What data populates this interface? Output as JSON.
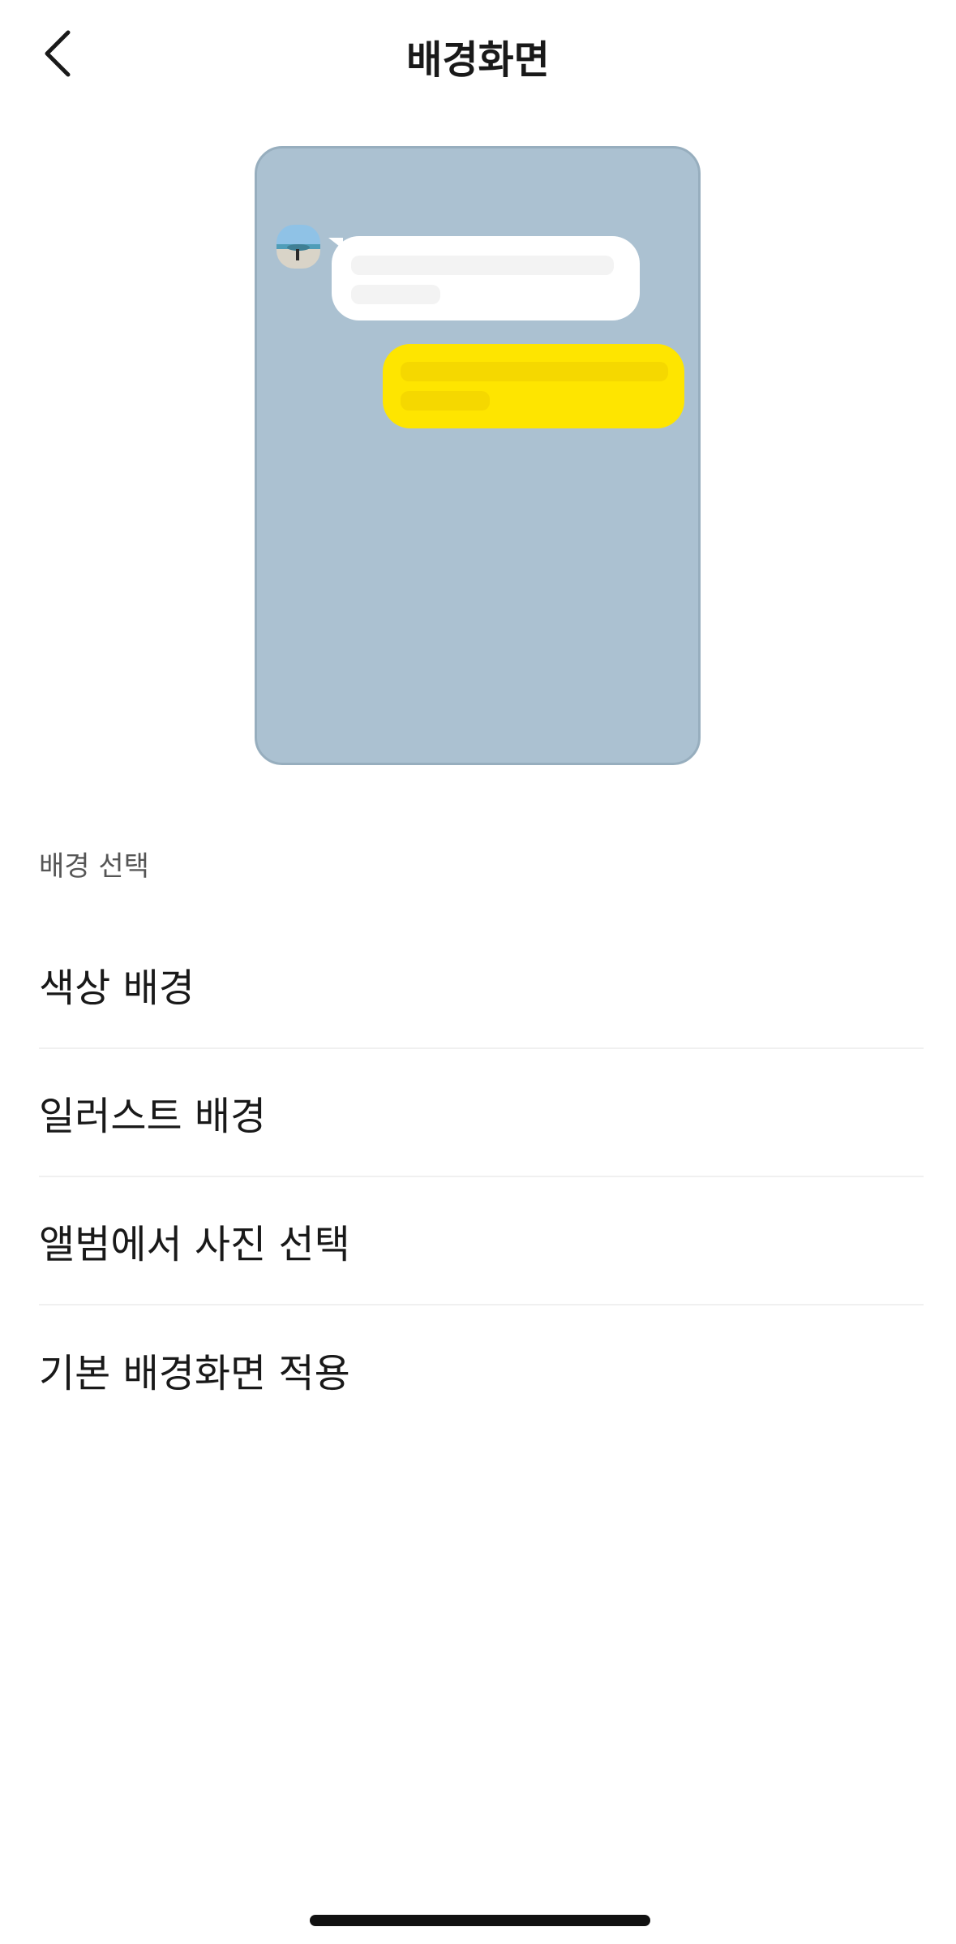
{
  "header": {
    "title": "배경화면",
    "back_icon": "chevron-left-icon"
  },
  "preview": {
    "background_color": "#abc1d1",
    "received_bubble_color": "#ffffff",
    "sent_bubble_color": "#fee500",
    "received_skeleton_color": "#f3f3f3",
    "sent_skeleton_color": "#f5d800",
    "avatar_icon": "profile-photo-icon"
  },
  "section": {
    "label": "배경 선택"
  },
  "menu": {
    "items": [
      {
        "label": "색상 배경"
      },
      {
        "label": "일러스트 배경"
      },
      {
        "label": "앨범에서 사진 선택"
      },
      {
        "label": "기본 배경화면 적용"
      }
    ]
  }
}
